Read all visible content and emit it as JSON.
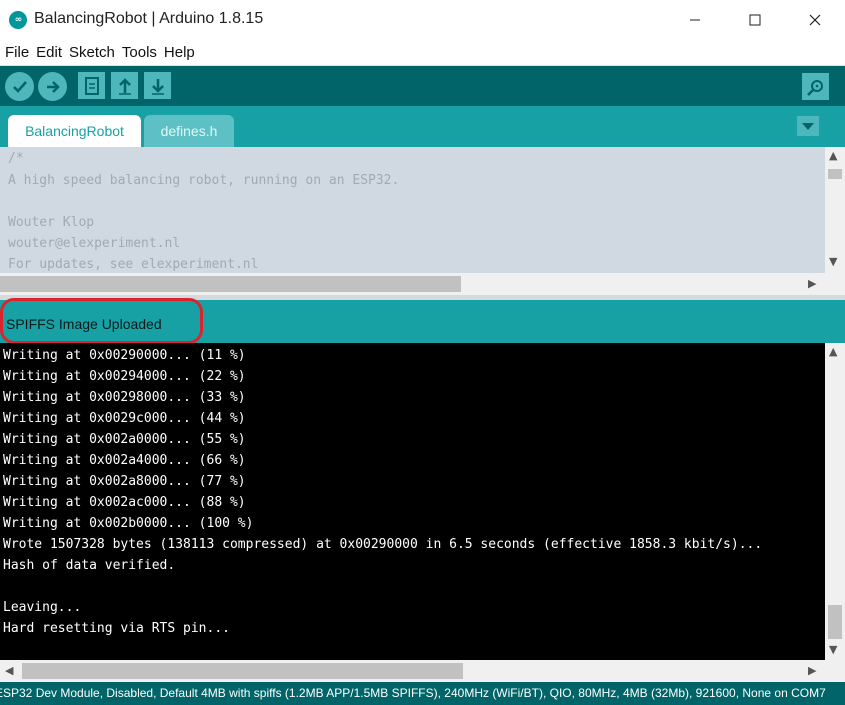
{
  "window": {
    "title": "BalancingRobot | Arduino 1.8.15",
    "logo_icon": "arduino-logo-icon",
    "controls": [
      "minimize-icon",
      "maximize-icon",
      "close-icon"
    ]
  },
  "menu": {
    "items": [
      {
        "label": "File"
      },
      {
        "label": "Edit"
      },
      {
        "label": "Sketch"
      },
      {
        "label": "Tools"
      },
      {
        "label": "Help"
      }
    ]
  },
  "toolbar": {
    "buttons": [
      {
        "name": "verify",
        "icon": "checkmark-icon"
      },
      {
        "name": "upload",
        "icon": "arrow-right-icon"
      },
      {
        "name": "new",
        "icon": "new-file-icon"
      },
      {
        "name": "open",
        "icon": "arrow-up-icon"
      },
      {
        "name": "save",
        "icon": "arrow-down-icon"
      }
    ],
    "serial_monitor_icon": "magnifier-icon"
  },
  "tabs": [
    {
      "label": "BalancingRobot",
      "active": true
    },
    {
      "label": "defines.h",
      "active": false
    }
  ],
  "editor": {
    "lines": [
      "/*",
      "A high speed balancing robot, running on an ESP32.",
      "",
      "Wouter Klop",
      "wouter@elexperiment.nl",
      "For updates, see elexperiment.nl"
    ]
  },
  "status": {
    "message": "SPIFFS Image Uploaded",
    "highlight_color": "#d9262c"
  },
  "console": {
    "lines": [
      "Writing at 0x00290000... (11 %)",
      "Writing at 0x00294000... (22 %)",
      "Writing at 0x00298000... (33 %)",
      "Writing at 0x0029c000... (44 %)",
      "Writing at 0x002a0000... (55 %)",
      "Writing at 0x002a4000... (66 %)",
      "Writing at 0x002a8000... (77 %)",
      "Writing at 0x002ac000... (88 %)",
      "Writing at 0x002b0000... (100 %)",
      "Wrote 1507328 bytes (138113 compressed) at 0x00290000 in 6.5 seconds (effective 1858.3 kbit/s)...",
      "Hash of data verified.",
      "",
      "Leaving...",
      "Hard resetting via RTS pin..."
    ]
  },
  "footer": {
    "board_info": "ESP32 Dev Module, Disabled, Default 4MB with spiffs (1.2MB APP/1.5MB SPIFFS), 240MHz (WiFi/BT), QIO, 80MHz, 4MB (32Mb), 921600, None on COM7"
  },
  "colors": {
    "toolbar_dark": "#006468",
    "teal": "#17a1a5",
    "editor_bg": "#d0d9e2",
    "console_bg": "#000000"
  }
}
